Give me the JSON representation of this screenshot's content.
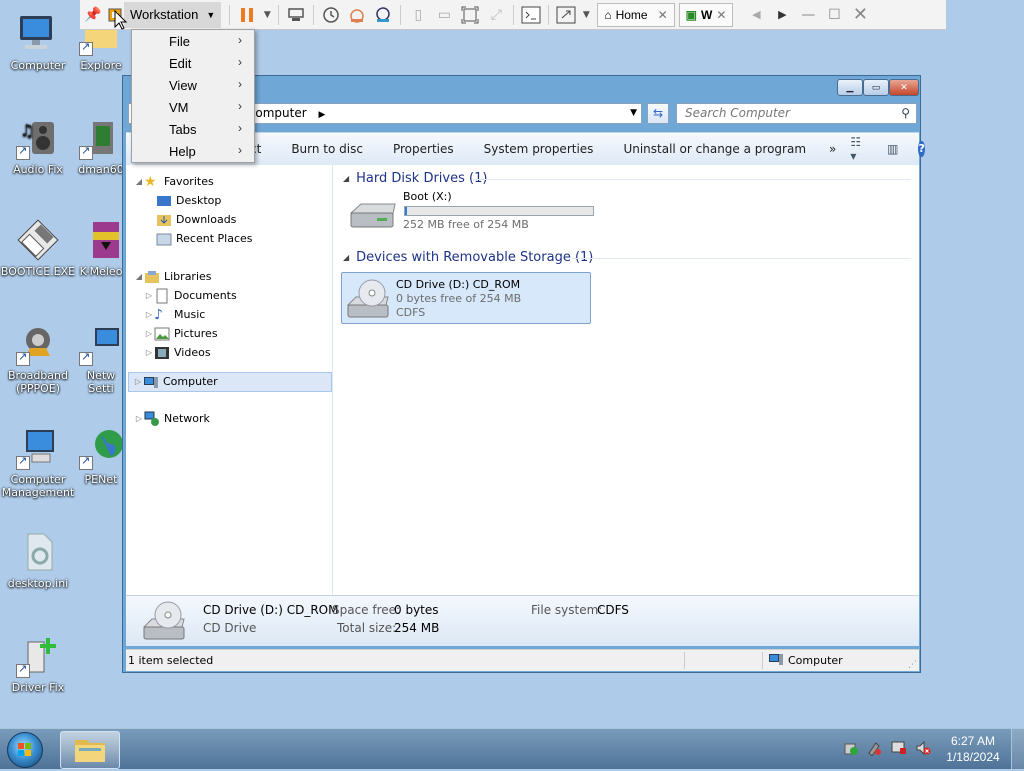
{
  "desktop": {
    "icons": [
      {
        "label": "Computer"
      },
      {
        "label": "Explore"
      },
      {
        "label": "Audio Fix"
      },
      {
        "label": "dman60"
      },
      {
        "label": "BOOTICE.EXE"
      },
      {
        "label": "K-Meleo"
      },
      {
        "label": "Broadband (PPPOE)"
      },
      {
        "label": "Netw Setti"
      },
      {
        "label": "Computer Management"
      },
      {
        "label": "PENet"
      },
      {
        "label": "desktop.ini"
      },
      {
        "label": "Driver Fix"
      }
    ]
  },
  "vm_toolbar": {
    "menu_label": "Workstation",
    "tabs": [
      {
        "label": "Home"
      },
      {
        "label": "W"
      }
    ]
  },
  "workstation_menu": {
    "items": [
      "File",
      "Edit",
      "View",
      "VM",
      "Tabs",
      "Help"
    ]
  },
  "explorer": {
    "address": "Computer",
    "search_placeholder": "Search Computer",
    "commands": [
      "ct",
      "Burn to disc",
      "Properties",
      "System properties",
      "Uninstall or change a program"
    ],
    "nav": {
      "favorites": "Favorites",
      "favorites_items": [
        "Desktop",
        "Downloads",
        "Recent Places"
      ],
      "libraries": "Libraries",
      "libraries_items": [
        "Documents",
        "Music",
        "Pictures",
        "Videos"
      ],
      "computer": "Computer",
      "network": "Network"
    },
    "groups": {
      "hdd_header": "Hard Disk Drives (1)",
      "removable_header": "Devices with Removable Storage (1)"
    },
    "drives": {
      "boot_name": "Boot (X:)",
      "boot_free": "252 MB free of 254 MB",
      "boot_used_fraction": 0.008,
      "cd_name": "CD Drive (D:) CD_ROM",
      "cd_free": "0 bytes free of 254 MB",
      "cd_fs": "CDFS"
    },
    "details": {
      "name": "CD Drive (D:) CD_ROM",
      "type": "CD Drive",
      "space_free_label": "Space free:",
      "space_free_value": "0 bytes",
      "total_size_label": "Total size:",
      "total_size_value": "254 MB",
      "fs_label": "File system:",
      "fs_value": "CDFS"
    },
    "status": {
      "selection": "1 item selected",
      "location": "Computer"
    }
  },
  "taskbar": {
    "time": "6:27 AM",
    "date": "1/18/2024"
  }
}
